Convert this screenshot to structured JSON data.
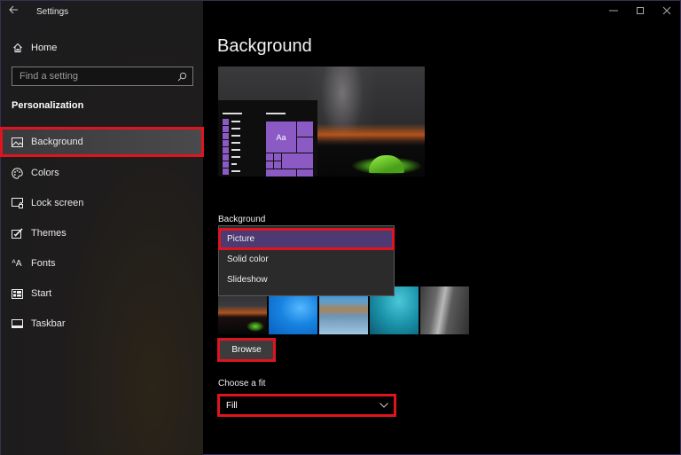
{
  "window": {
    "title": "Settings",
    "controls": {
      "minimize": "minimize",
      "maximize": "maximize",
      "close": "close"
    }
  },
  "sidebar": {
    "home_label": "Home",
    "search_placeholder": "Find a setting",
    "section_title": "Personalization",
    "items": [
      {
        "label": "Background",
        "icon": "picture-icon",
        "active": true
      },
      {
        "label": "Colors",
        "icon": "palette-icon",
        "active": false
      },
      {
        "label": "Lock screen",
        "icon": "lock-screen-icon",
        "active": false
      },
      {
        "label": "Themes",
        "icon": "themes-icon",
        "active": false
      },
      {
        "label": "Fonts",
        "icon": "fonts-icon",
        "active": false
      },
      {
        "label": "Start",
        "icon": "start-icon",
        "active": false
      },
      {
        "label": "Taskbar",
        "icon": "taskbar-icon",
        "active": false
      }
    ]
  },
  "main": {
    "page_title": "Background",
    "preview": {
      "tile_text": "Aa"
    },
    "background_label": "Background",
    "background_options": [
      {
        "label": "Picture",
        "selected": true
      },
      {
        "label": "Solid color",
        "selected": false
      },
      {
        "label": "Slideshow",
        "selected": false
      }
    ],
    "thumbnails": [
      "night-camp",
      "windows-blue",
      "beach-rocks",
      "underwater",
      "waterfall"
    ],
    "browse_label": "Browse",
    "fit_label": "Choose a fit",
    "fit_value": "Fill"
  },
  "colors": {
    "accent": "#8b5ac4",
    "highlight_border": "#e0141e",
    "selected_option": "#4e3a72"
  }
}
